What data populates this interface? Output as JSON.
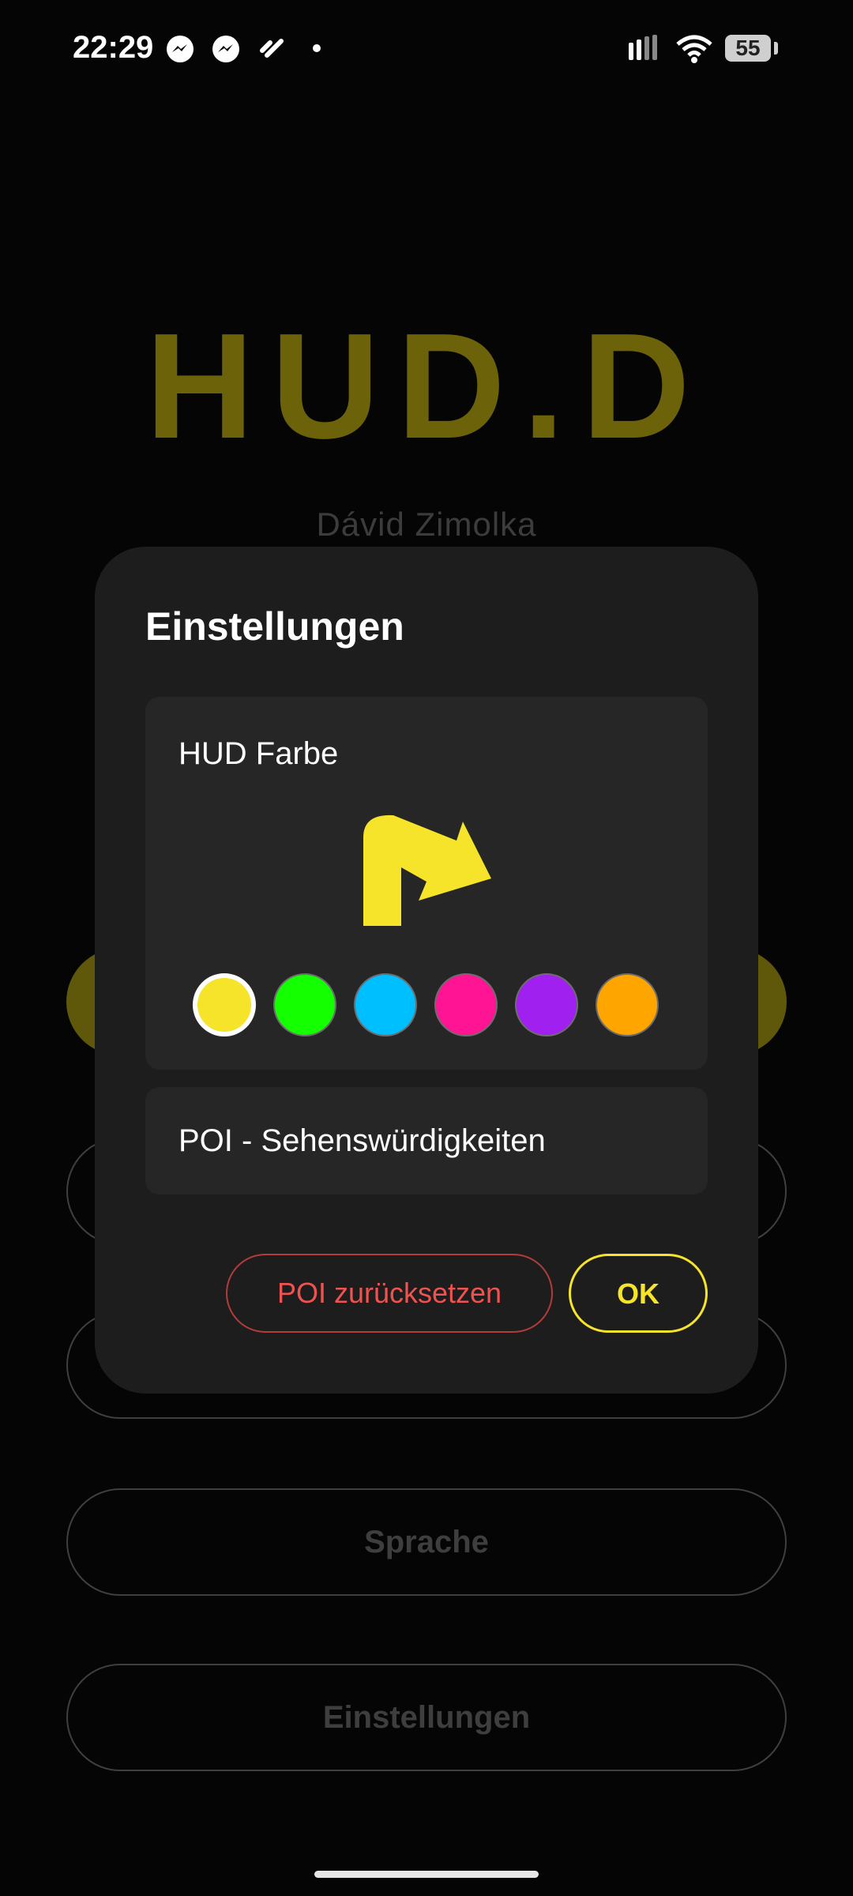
{
  "status_bar": {
    "time": "22:29",
    "battery": "55",
    "icons": [
      "messenger-icon",
      "messenger-icon",
      "app-icon",
      "notification-dot",
      "signal-icon",
      "wifi-icon",
      "battery-icon"
    ]
  },
  "background": {
    "app_title": "HUD.D",
    "author": "Dávid Zimolka",
    "buttons": [
      "Sprache",
      "Einstellungen"
    ]
  },
  "dialog": {
    "title": "Einstellungen",
    "hud_color": {
      "label": "HUD Farbe",
      "preview_icon": "turn-arrow-icon",
      "selected": "#F5E42A",
      "swatches": [
        "#F5E42A",
        "#14FF00",
        "#00BFFF",
        "#FF1493",
        "#A020F0",
        "#FFA500"
      ]
    },
    "poi": {
      "label": "POI - Sehenswürdigkeiten"
    },
    "buttons": {
      "reset": "POI zurücksetzen",
      "ok": "OK"
    }
  }
}
